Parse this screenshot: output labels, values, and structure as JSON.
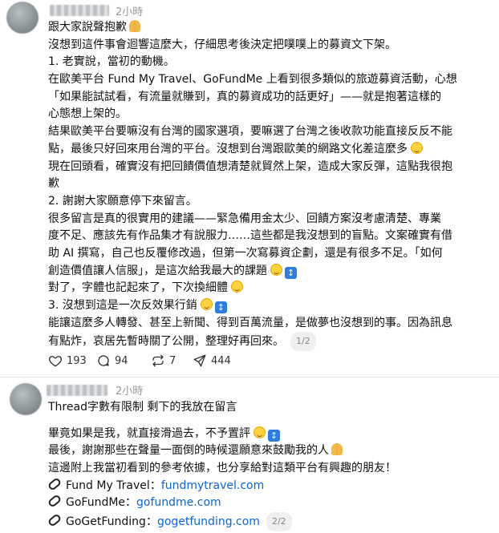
{
  "post1": {
    "time": "2小時",
    "lines": [
      "跟大家說聲抱歉",
      "沒想到這件事會迴響這麼大，仔細思考後決定把噗噗上的募資文下架。",
      "1. 老實說，當初的動機。",
      "在歐美平台 Fund My Travel、GoFundMe 上看到很多類似的旅遊募資活動，心想",
      "「如果能試試看，有流量就賺到，真的募資成功的話更好」——就是抱著這樣的",
      "心態想上架的。",
      "結果歐美平台要嘛沒有台灣的國家選項，要嘛選了台灣之後收款功能直接反反不能",
      "點，最後只好回來用台灣的平台。沒想到台灣跟歐美的網路文化差這麼多",
      "現在回頭看，確實沒有把回饋價值想清楚就貿然上架，造成大家反彈，這點我很抱",
      "歉",
      "2. 謝謝大家願意停下來留言。",
      "很多留言是真的很實用的建議——緊急備用金太少、回饋方案沒考慮清楚、專業",
      "度不足、應該先有作品集才有說服力……這些都是我沒想到的盲點。文案確實有借",
      "助 AI 撰寫，自己也反覆修改過，但第一次寫募資企劃，還是有很多不足。「如何",
      "創造價值讓人信服」，是這次給我最大的課題",
      "對了，字體也記起來了，下次換細體",
      "3. 沒想到這是一次反效果行銷",
      "能讓這麼多人轉發、甚至上新聞、得到百萬流量，是做夢也沒想到的事。因為訊息",
      "有點炸，哀居先暫時關了公開，整理好再回來。"
    ],
    "page_badge": "1/2",
    "actions": {
      "likes": "193",
      "comments": "94",
      "reposts": "7",
      "shares": "444"
    }
  },
  "post2": {
    "time": "2小時",
    "intro": "Thread字數有限制 剩下的我放在留言",
    "lines": [
      "畢竟如果是我，就直接滑過去，不予置評",
      "最後，謝謝那些在聲量一面倒的時候還願意來鼓勵我的人",
      "這邊附上我當初看到的參考依據，也分享給對這類平台有興趣的朋友！"
    ],
    "links": [
      {
        "name": "Fund My Travel",
        "sep": "：",
        "url": "fundmytravel.com"
      },
      {
        "name": "GoFundMe",
        "sep": "：",
        "url": "gofundme.com"
      },
      {
        "name": "GoGetFunding",
        "sep": "：",
        "url": "gogetfunding.com"
      }
    ],
    "page_badge": "2/2"
  },
  "icons": {
    "like": "heart-icon",
    "comment": "comment-icon",
    "repost": "repost-icon",
    "share": "share-icon",
    "more": "more-icon",
    "link": "link-icon"
  }
}
